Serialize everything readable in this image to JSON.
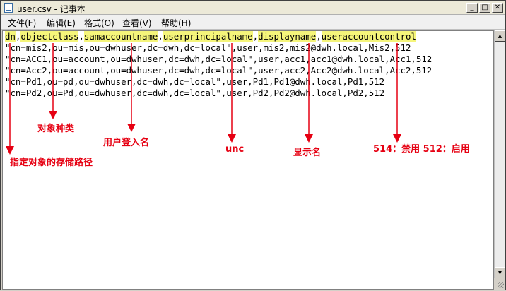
{
  "window": {
    "title": "user.csv - 记事本",
    "controls": [
      "minimize-icon",
      "maximize-icon",
      "close-icon"
    ]
  },
  "menu": {
    "items": [
      "文件(F)",
      "编辑(E)",
      "格式(O)",
      "查看(V)",
      "帮助(H)"
    ]
  },
  "file": {
    "header_fields": [
      "dn",
      "objectclass",
      "samaccountname",
      "userprincipalname",
      "displayname",
      "useraccountcontrol"
    ],
    "lines": [
      "\"cn=mis2,ou=mis,ou=dwhuser,dc=dwh,dc=local\",user,mis2,mis2@dwh.local,Mis2,512",
      "\"cn=ACC1,ou=account,ou=dwhuser,dc=dwh,dc=local\",user,acc1,acc1@dwh.local,Acc1,512",
      "\"cn=Acc2,ou=account,ou=dwhuser,dc=dwh,dc=local\",user,acc2,Acc2@dwh.local,Acc2,512",
      "\"cn=Pd1,ou=pd,ou=dwhuser,dc=dwh,dc=local\",user,Pd1,Pd1@dwh.local,Pd1,512",
      "\"cn=Pd2,ou=Pd,ou=dwhuser,dc=dwh,dc=local\",user,Pd2,Pd2@dwh.local,Pd2,512"
    ]
  },
  "annotations": {
    "dn": "指定对象的存储路径",
    "objectclass": "对象种类",
    "samaccountname": "用户登入名",
    "userprincipalname": "unc",
    "displayname": "显示名",
    "useraccountcontrol": "514：禁用 512：启用"
  },
  "colors": {
    "annotation": "#e60012",
    "highlight": "#f5f57a"
  }
}
